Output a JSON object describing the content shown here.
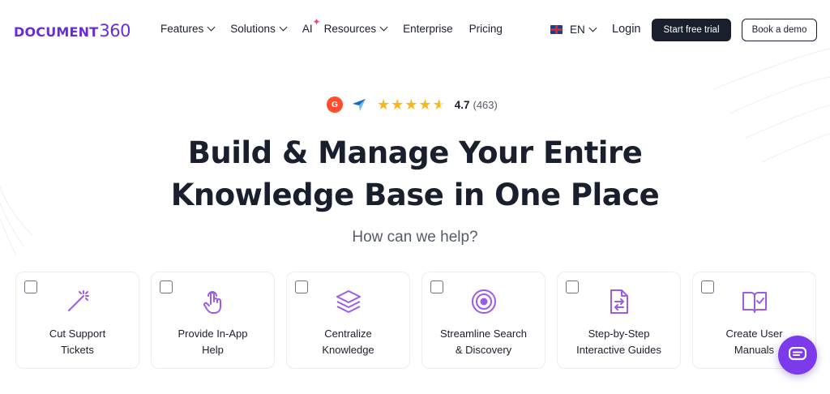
{
  "logo": {
    "word": "DOCUMENT",
    "num": "360"
  },
  "nav": {
    "features": "Features",
    "solutions": "Solutions",
    "ai": "AI",
    "resources": "Resources",
    "enterprise": "Enterprise",
    "pricing": "Pricing"
  },
  "language": "EN",
  "login": "Login",
  "cta": {
    "trial": "Start free trial",
    "demo": "Book a demo"
  },
  "rating": {
    "score": "4.7",
    "count": "(463)",
    "stars": 4.5
  },
  "hero": {
    "line1": "Build & Manage Your Entire",
    "line2": "Knowledge Base in One Place",
    "subtitle": "How can we help?"
  },
  "cards": [
    {
      "line1": "Cut Support",
      "line2": "Tickets",
      "icon": "magic-wand-icon"
    },
    {
      "line1": "Provide In-App",
      "line2": "Help",
      "icon": "pointer-hand-icon"
    },
    {
      "line1": "Centralize",
      "line2": "Knowledge",
      "icon": "layers-icon"
    },
    {
      "line1": "Streamline Search",
      "line2": "& Discovery",
      "icon": "target-icon"
    },
    {
      "line1": "Step-by-Step",
      "line2": "Interactive Guides",
      "icon": "document-steps-icon"
    },
    {
      "line1": "Create User",
      "line2": "Manuals",
      "icon": "book-check-icon"
    }
  ],
  "colors": {
    "brand": "#6a2bd9",
    "icon": "#9b5de5",
    "dark": "#1a1f2e",
    "star": "#f6b81a",
    "chat": "#7c3aed"
  }
}
